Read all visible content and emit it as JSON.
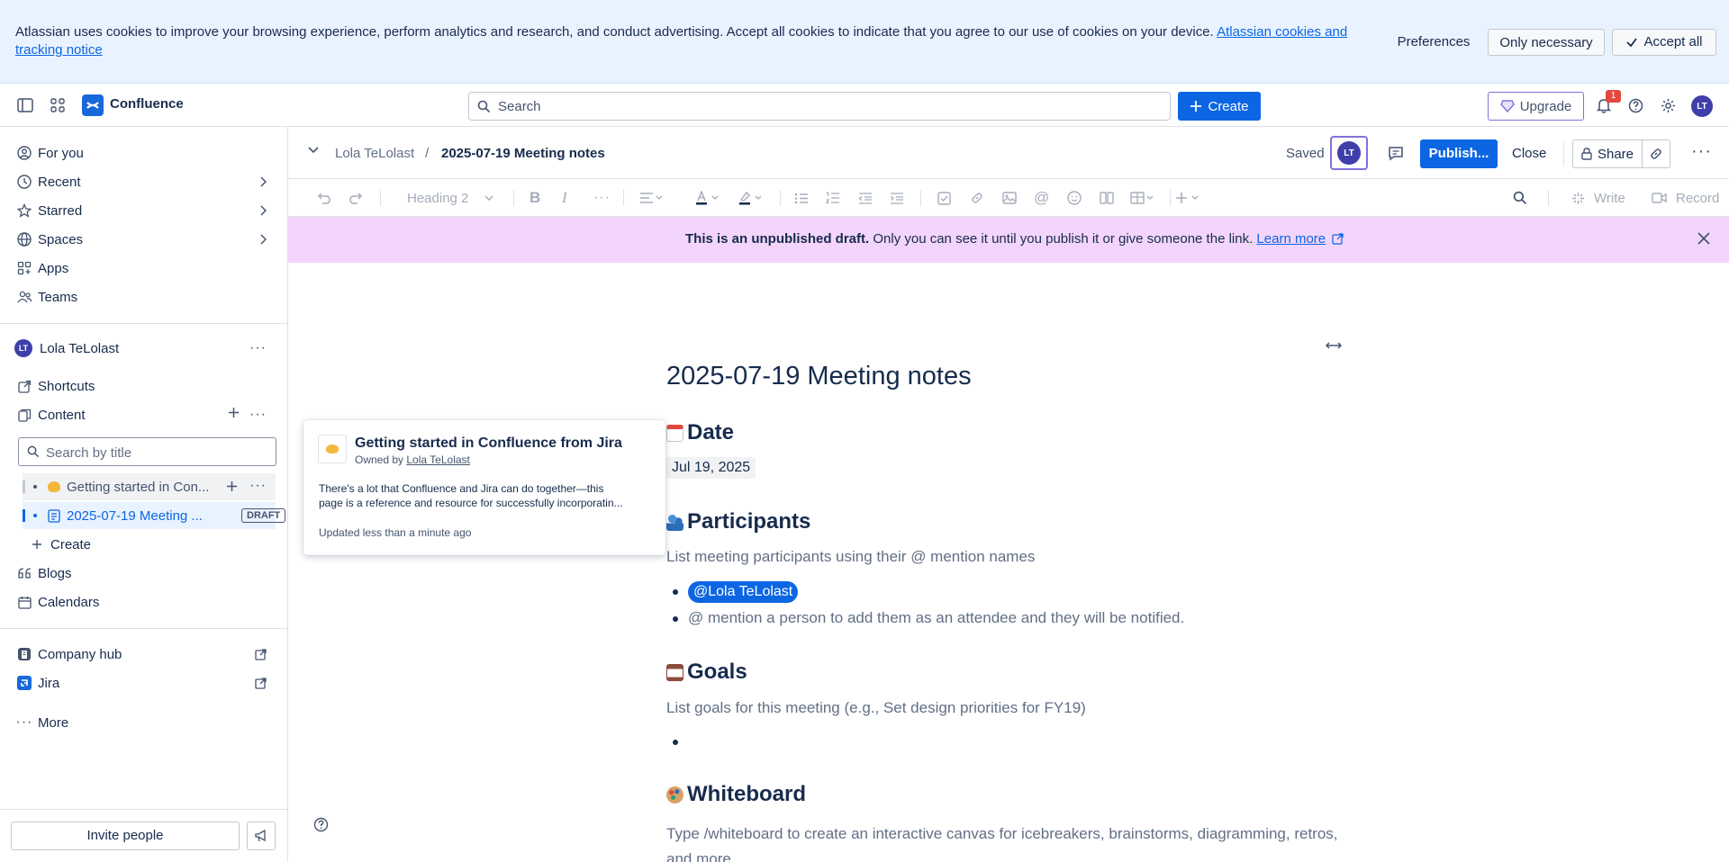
{
  "cookie_banner": {
    "message": "Atlassian uses cookies to improve your browsing experience, perform analytics and research, and conduct advertising. Accept all cookies to indicate that you agree to our use of cookies on your device.",
    "link_text": "Atlassian cookies and tracking notice",
    "preferences": "Preferences",
    "only_necessary": "Only necessary",
    "accept_all": "Accept all"
  },
  "topnav": {
    "brand": "Confluence",
    "search_placeholder": "Search",
    "create_label": "Create",
    "upgrade_label": "Upgrade",
    "notification_count": "1",
    "avatar_initials": "LT"
  },
  "sidebar": {
    "items": [
      {
        "label": "For you",
        "icon": "person-circle-icon"
      },
      {
        "label": "Recent",
        "icon": "clock-icon"
      },
      {
        "label": "Starred",
        "icon": "star-icon"
      },
      {
        "label": "Spaces",
        "icon": "globe-icon"
      },
      {
        "label": "Apps",
        "icon": "apps-icon"
      },
      {
        "label": "Teams",
        "icon": "people-icon"
      }
    ],
    "space_name": "Lola TeLolast",
    "space_initials": "LT",
    "shortcuts": "Shortcuts",
    "content": "Content",
    "search_placeholder": "Search by title",
    "tree": [
      {
        "label": "Getting started in Con..."
      },
      {
        "label": "2025-07-19 Meeting ...",
        "badge": "DRAFT"
      }
    ],
    "tree_create": "Create",
    "blogs": "Blogs",
    "calendars": "Calendars",
    "company_hub": "Company hub",
    "jira": "Jira",
    "more": "More",
    "invite": "Invite people"
  },
  "page_header": {
    "breadcrumb_space": "Lola TeLolast",
    "breadcrumb_sep": "/",
    "breadcrumb_page": "2025-07-19 Meeting notes",
    "saved": "Saved",
    "publish": "Publish...",
    "close": "Close",
    "share": "Share"
  },
  "toolbar": {
    "style": "Heading 2",
    "write": "Write",
    "record": "Record"
  },
  "draft_banner": {
    "bold": "This is an unpublished draft.",
    "text": " Only you can see it until you publish it or give someone the link. ",
    "link": "Learn more"
  },
  "document": {
    "title": "2025-07-19 Meeting notes",
    "date_heading": "Date",
    "date_value": "Jul 19, 2025",
    "participants_heading": "Participants",
    "participants_hint": "List meeting participants using their @ mention names",
    "mention": "@Lola TeLolast",
    "participants_bullet2": "@ mention a person to add them as an attendee and they will be notified.",
    "goals_heading": "Goals",
    "goals_hint": "List goals for this meeting (e.g., Set design priorities for FY19)",
    "whiteboard_heading": "Whiteboard",
    "whiteboard_hint_line1": "Type /whiteboard to create an interactive canvas for icebreakers, brainstorms, diagramming, retros,",
    "whiteboard_hint_line2": "and more"
  },
  "hover_card": {
    "title": "Getting started in Confluence from Jira",
    "owned_by": "Owned by",
    "owner": "Lola TeLolast",
    "excerpt_line1": "There's a lot that Confluence and Jira can do together—this",
    "excerpt_line2": "page is a reference and resource for successfully incorporatin...",
    "updated": "Updated less than a minute ago"
  },
  "colors": {
    "primary": "#0c66e4",
    "banner_bg": "#e9f2ff",
    "draft_bg": "#f3d4fb",
    "avatar": "#3f3fab"
  }
}
